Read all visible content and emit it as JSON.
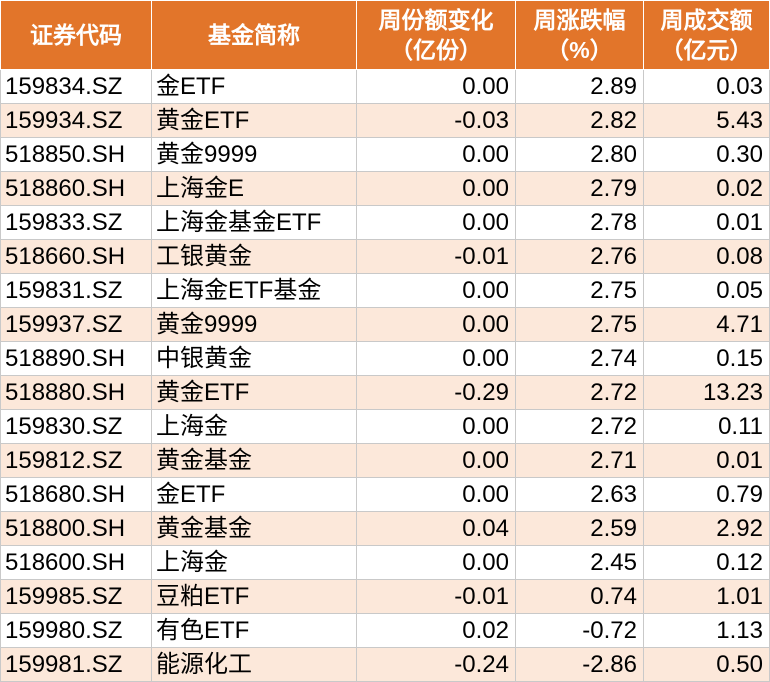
{
  "header": {
    "code": "证券代码",
    "name": "基金简称",
    "share_change_line1": "周份额变化",
    "share_change_line2": "（亿份）",
    "weekly_change_line1": "周涨跌幅",
    "weekly_change_line2": "（%）",
    "turnover_line1": "周成交额",
    "turnover_line2": "（亿元）"
  },
  "rows": [
    {
      "code": "159834.SZ",
      "name": "金ETF",
      "share_change": "0.00",
      "weekly_change": "2.89",
      "turnover": "0.03"
    },
    {
      "code": "159934.SZ",
      "name": "黄金ETF",
      "share_change": "-0.03",
      "weekly_change": "2.82",
      "turnover": "5.43"
    },
    {
      "code": "518850.SH",
      "name": "黄金9999",
      "share_change": "0.00",
      "weekly_change": "2.80",
      "turnover": "0.30"
    },
    {
      "code": "518860.SH",
      "name": "上海金E",
      "share_change": "0.00",
      "weekly_change": "2.79",
      "turnover": "0.02"
    },
    {
      "code": "159833.SZ",
      "name": "上海金基金ETF",
      "share_change": "0.00",
      "weekly_change": "2.78",
      "turnover": "0.01"
    },
    {
      "code": "518660.SH",
      "name": "工银黄金",
      "share_change": "-0.01",
      "weekly_change": "2.76",
      "turnover": "0.08"
    },
    {
      "code": "159831.SZ",
      "name": "上海金ETF基金",
      "share_change": "0.00",
      "weekly_change": "2.75",
      "turnover": "0.05"
    },
    {
      "code": "159937.SZ",
      "name": "黄金9999",
      "share_change": "0.00",
      "weekly_change": "2.75",
      "turnover": "4.71"
    },
    {
      "code": "518890.SH",
      "name": "中银黄金",
      "share_change": "0.00",
      "weekly_change": "2.74",
      "turnover": "0.15"
    },
    {
      "code": "518880.SH",
      "name": "黄金ETF",
      "share_change": "-0.29",
      "weekly_change": "2.72",
      "turnover": "13.23"
    },
    {
      "code": "159830.SZ",
      "name": "上海金",
      "share_change": "0.00",
      "weekly_change": "2.72",
      "turnover": "0.11"
    },
    {
      "code": "159812.SZ",
      "name": "黄金基金",
      "share_change": "0.00",
      "weekly_change": "2.71",
      "turnover": "0.01"
    },
    {
      "code": "518680.SH",
      "name": "金ETF",
      "share_change": "0.00",
      "weekly_change": "2.63",
      "turnover": "0.79"
    },
    {
      "code": "518800.SH",
      "name": "黄金基金",
      "share_change": "0.04",
      "weekly_change": "2.59",
      "turnover": "2.92"
    },
    {
      "code": "518600.SH",
      "name": "上海金",
      "share_change": "0.00",
      "weekly_change": "2.45",
      "turnover": "0.12"
    },
    {
      "code": "159985.SZ",
      "name": "豆粕ETF",
      "share_change": "-0.01",
      "weekly_change": "0.74",
      "turnover": "1.01"
    },
    {
      "code": "159980.SZ",
      "name": "有色ETF",
      "share_change": "0.02",
      "weekly_change": "-0.72",
      "turnover": "1.13"
    },
    {
      "code": "159981.SZ",
      "name": "能源化工",
      "share_change": "-0.24",
      "weekly_change": "-2.86",
      "turnover": "0.50"
    }
  ],
  "colors": {
    "header_bg": "#e2752a",
    "header_text": "#ffffff",
    "stripe_bg": "#fce8da"
  }
}
